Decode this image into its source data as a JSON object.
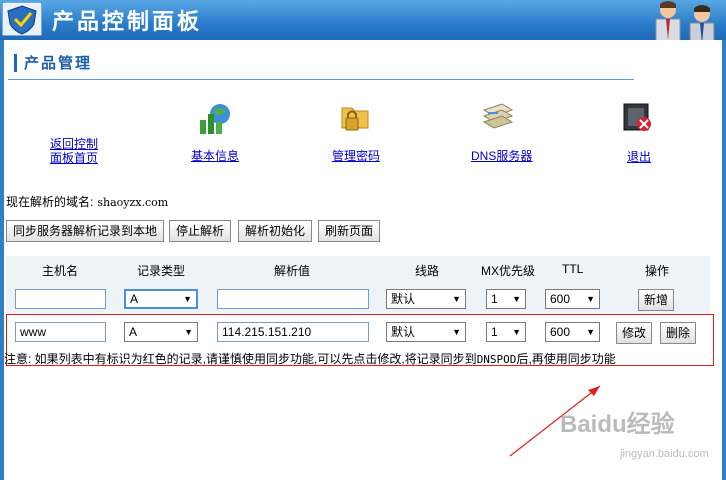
{
  "header": {
    "title": "产品控制面板"
  },
  "section": {
    "title": "产品管理"
  },
  "nav": {
    "home": {
      "line1": "返回控制",
      "line2": "面板首页"
    },
    "basic_info": "基本信息",
    "manage_password": "管理密码",
    "dns_server": "DNS服务器",
    "logout": "退出"
  },
  "domain": {
    "label": "现在解析的域名:",
    "value": "shaoyzx.com"
  },
  "toolbar": {
    "sync_label": "同步服务器解析记录到本地",
    "stop_label": "停止解析",
    "init_label": "解析初始化",
    "refresh_label": "刷新页面"
  },
  "table": {
    "headers": [
      "主机名",
      "记录类型",
      "解析值",
      "线路",
      "MX优先级",
      "TTL",
      "操作"
    ],
    "new_row": {
      "host": "",
      "type": "A",
      "value": "",
      "line": "默认",
      "mx": "1",
      "ttl": "600",
      "action": "新增"
    },
    "rows": [
      {
        "host": "www",
        "type": "A",
        "value": "114.215.151.210",
        "line": "默认",
        "mx": "1",
        "ttl": "600",
        "edit": "修改",
        "delete": "删除"
      }
    ]
  },
  "note": {
    "prefix": "注意:  如果列表中有标识为红色的记录,请谨慎使用同步功能,可以先点击修改,将记录同步到",
    "dns": "DNSPOD",
    "suffix": "后,再使用同步功能"
  },
  "watermark": {
    "text": "Baidu经验",
    "url": "jingyan.baidu.com"
  },
  "colors": {
    "header_blue": "#2a7ccb",
    "link": "#0000cc",
    "highlight": "#e02020"
  }
}
